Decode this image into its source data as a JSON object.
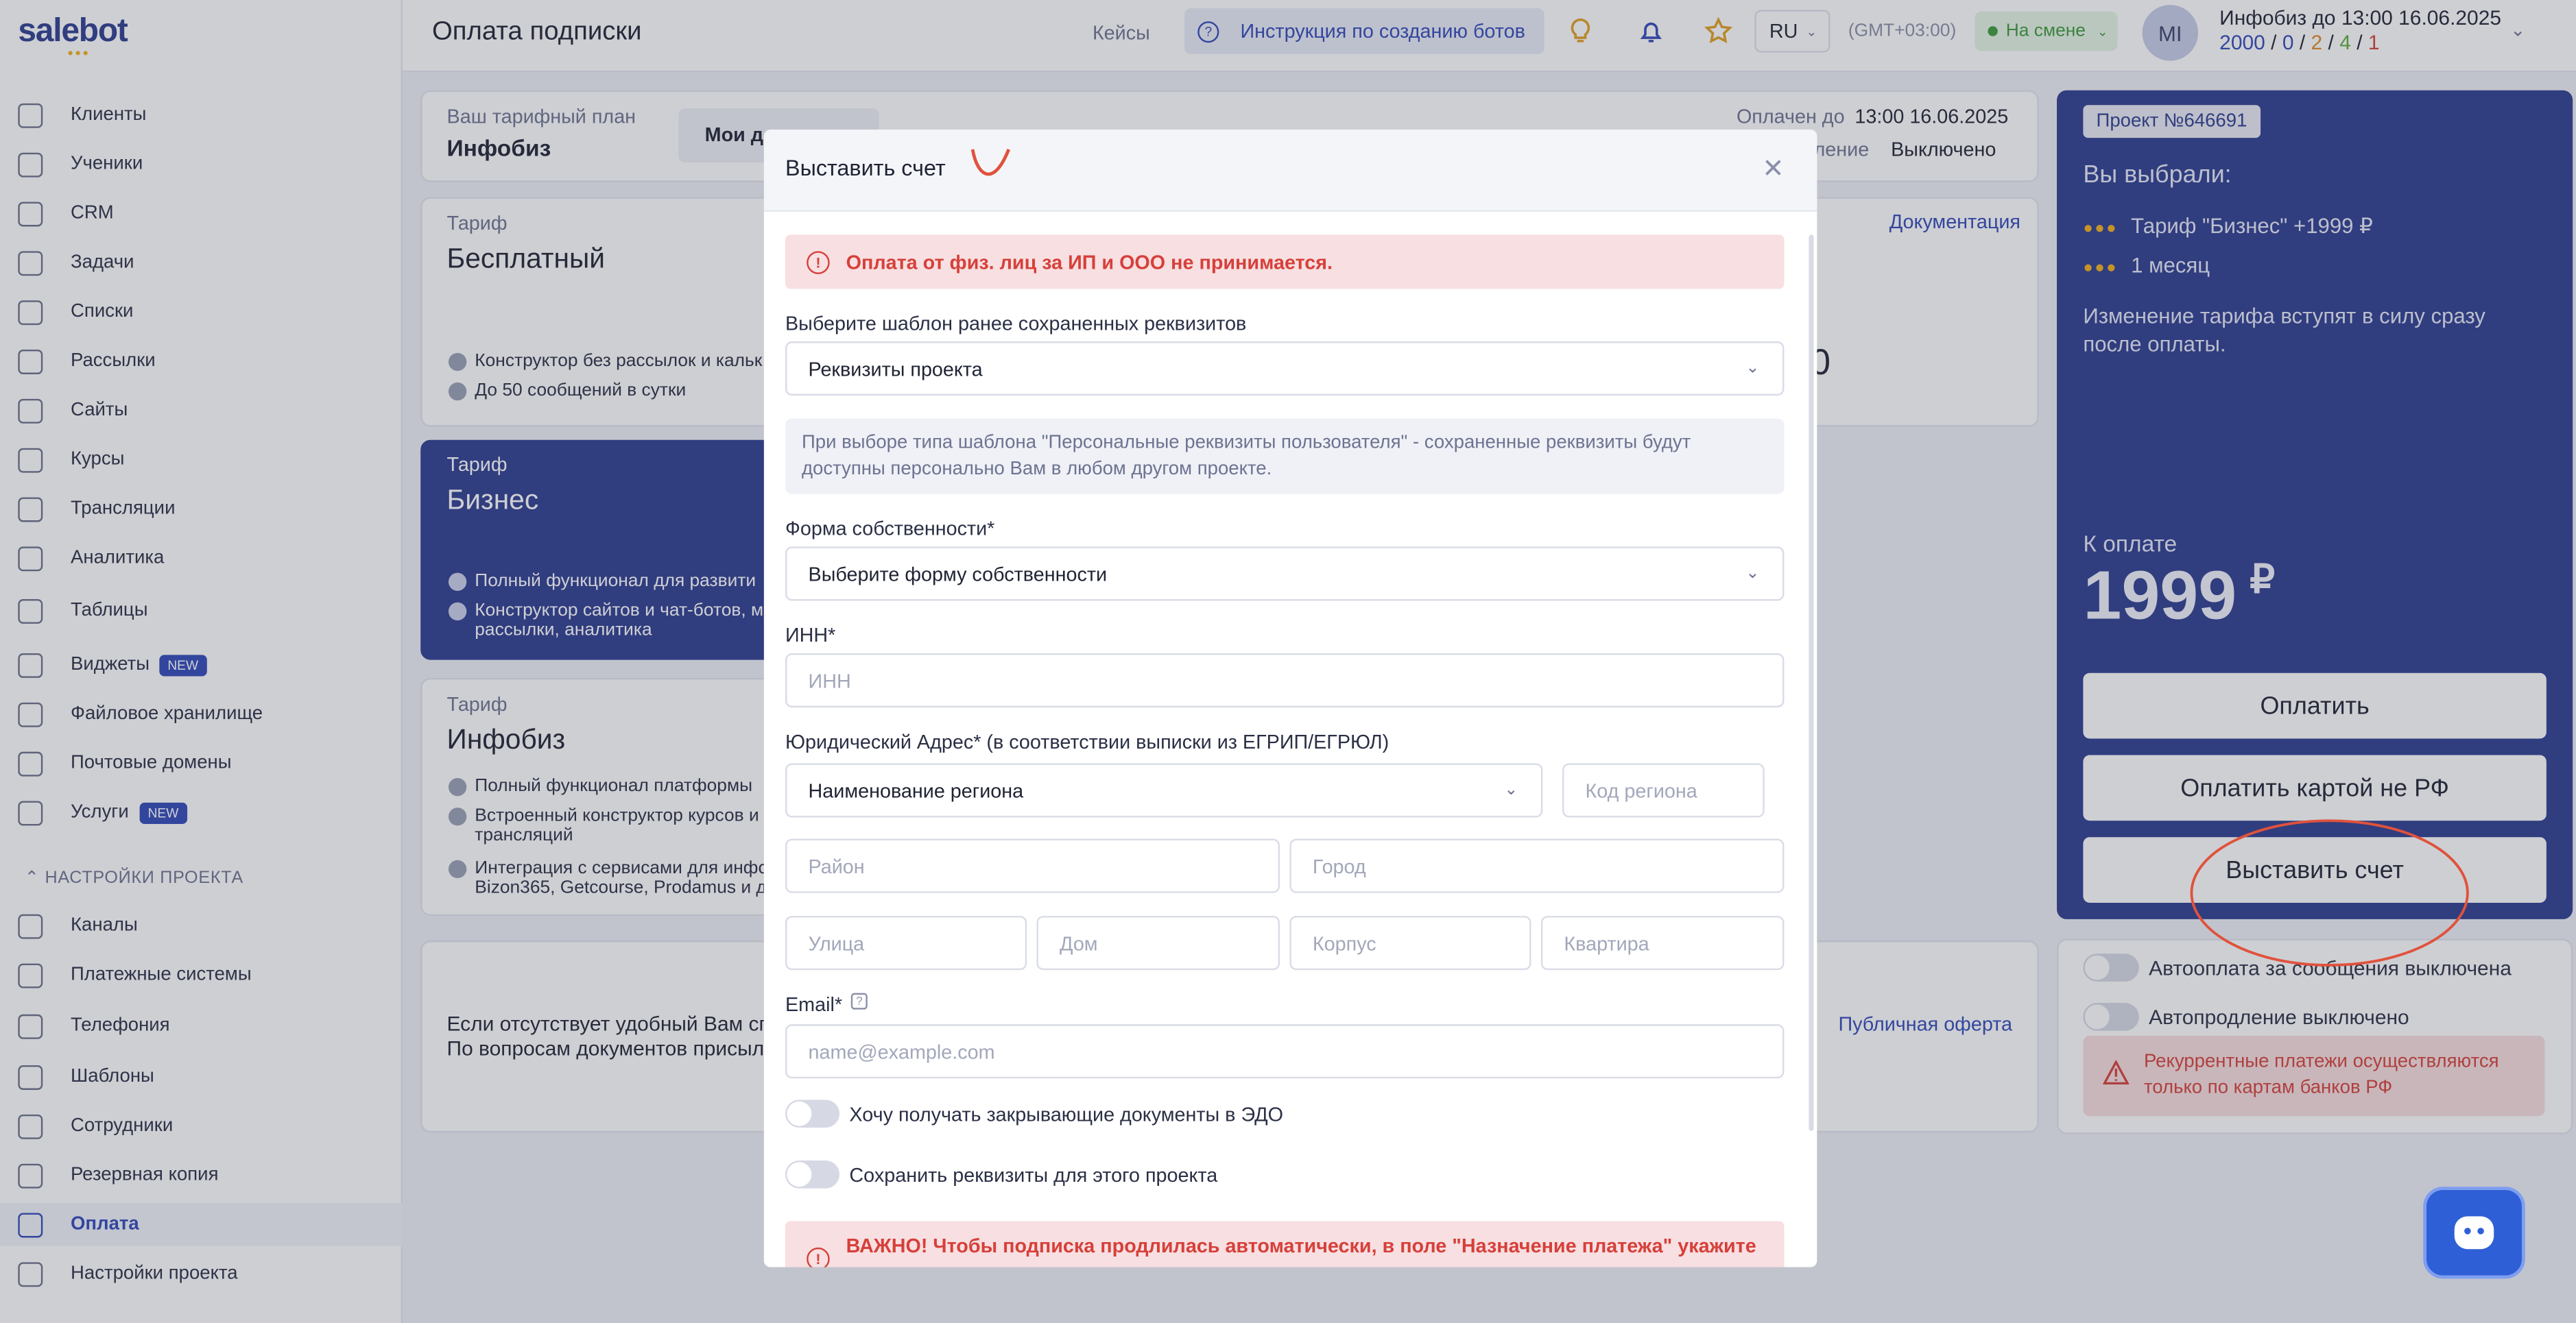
{
  "app": {
    "logo": "salebot",
    "page_title": "Оплата подписки"
  },
  "header": {
    "cases_link": "Кейсы",
    "guide_link": "Инструкция по созданию ботов",
    "language": "RU",
    "timezone": "(GMT+03:00)",
    "shift_status": "На смене",
    "avatar_initials": "MI",
    "account_name": "Инфобиз до 13:00 16.06.2025",
    "stats": [
      "2000",
      "0",
      "2",
      "4",
      "1"
    ],
    "stats_sep": "/",
    "stats_colors": [
      "#3048b8",
      "#3048b8",
      "#e08a1e",
      "#5aae3a",
      "#d6403a"
    ]
  },
  "sidebar": {
    "items": [
      {
        "label": "Клиенты"
      },
      {
        "label": "Ученики"
      },
      {
        "label": "CRM"
      },
      {
        "label": "Задачи"
      },
      {
        "label": "Списки"
      },
      {
        "label": "Рассылки"
      },
      {
        "label": "Сайты"
      },
      {
        "label": "Курсы"
      },
      {
        "label": "Трансляции"
      },
      {
        "label": "Аналитика"
      },
      {
        "label": "Таблицы"
      },
      {
        "label": "Виджеты",
        "badge": "NEW"
      },
      {
        "label": "Файловое хранилище"
      },
      {
        "label": "Почтовые домены"
      },
      {
        "label": "Услуги",
        "badge": "NEW"
      }
    ],
    "section": "НАСТРОЙКИ ПРОЕКТА",
    "settings_items": [
      {
        "label": "Каналы"
      },
      {
        "label": "Платежные системы"
      },
      {
        "label": "Телефония"
      },
      {
        "label": "Шаблоны"
      },
      {
        "label": "Сотрудники"
      },
      {
        "label": "Резервная копия"
      },
      {
        "label": "Оплата"
      },
      {
        "label": "Настройки проекта"
      }
    ]
  },
  "plan_bar": {
    "label": "Ваш тарифный план",
    "plan": "Инфобиз",
    "docs_btn": "Мои до",
    "paid_until_label": "Оплачен до",
    "paid_until": "13:00 16.06.2025",
    "renew_label": "дление",
    "renew_value": "Выключено"
  },
  "tariffs": {
    "docs_link": "Документация",
    "free": {
      "label": "Тариф",
      "name": "Бесплатный",
      "features": [
        "Конструктор без рассылок и кальк",
        "До 50 сообщений в сутки"
      ],
      "price_tail": "0"
    },
    "business": {
      "label": "Тариф",
      "name": "Бизнес",
      "features": [
        "Полный функционал для развити",
        "Конструктор сайтов и чат-ботов, м рассылки, аналитика"
      ]
    },
    "infobiz": {
      "label": "Тариф",
      "name": "Инфобиз",
      "features": [
        "Полный функционал платформы",
        "Встроенный конструктор курсов и трансляций",
        "Интеграция с сервисами для инфо Bizon365, Getcourse, Prodamus и др"
      ]
    }
  },
  "bottom_card": {
    "line1": "Если отсутствует удобный Вам сп",
    "line2": "По вопросам документов присыл",
    "offer_link": "Публичная оферта"
  },
  "summary": {
    "project": "Проект №646691",
    "chosen_title": "Вы выбрали:",
    "items": [
      "Тариф \"Бизнес\" +1999 ₽",
      "1 месяц"
    ],
    "note": "Изменение тарифа вступят в силу сразу после оплаты.",
    "to_pay_label": "К оплате",
    "amount": "1999",
    "currency": "₽",
    "pay_btn": "Оплатить",
    "pay_foreign_btn": "Оплатить картой не РФ",
    "invoice_btn": "Выставить счет",
    "autopay_label": "Автооплата за сообщения выключена",
    "autorenew_label": "Автопродление выключено",
    "recurring_warning": "Рекуррентные платежи осуществляются только по картам банков РФ"
  },
  "modal": {
    "title": "Выставить счет",
    "alert_top": "Оплата от физ. лиц за ИП и ООО не принимается.",
    "template_label": "Выберите шаблон ранее сохраненных реквизитов",
    "template_value": "Реквизиты проекта",
    "info_text": "При выборе типа шаблона \"Персональные реквизиты пользователя\" - сохраненные реквизиты будут доступны персонально Вам в любом другом проекте.",
    "ownership_label": "Форма собственности*",
    "ownership_placeholder": "Выберите форму собственности",
    "inn_label": "ИНН*",
    "inn_placeholder": "ИНН",
    "address_label": "Юридический Адрес* (в соответствии выписки из ЕГРИП/ЕГРЮЛ)",
    "region_placeholder": "Наименование региона",
    "region_code_placeholder": "Код региона",
    "district_placeholder": "Район",
    "city_placeholder": "Город",
    "street_placeholder": "Улица",
    "house_placeholder": "Дом",
    "building_placeholder": "Корпус",
    "apartment_placeholder": "Квартира",
    "email_label": "Email*",
    "email_placeholder": "name@example.com",
    "edo_toggle": "Хочу получать закрывающие документы в ЭДО",
    "save_toggle": "Сохранить реквизиты для этого проекта",
    "alert_bottom": "ВАЖНО! Чтобы подписка продлилась автоматически, в поле \"Назначение платежа\" укажите"
  },
  "annotation_color": "#e0523c",
  "accent": "#2d3d8f"
}
